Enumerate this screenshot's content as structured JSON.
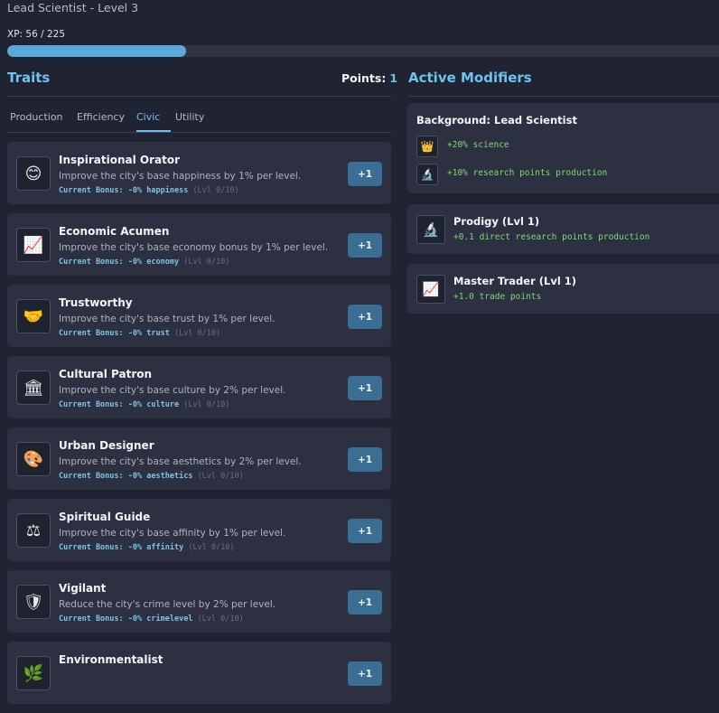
{
  "header": {
    "title": "Lead Scientist - Level 3",
    "xp_label": "XP: 56 / 225",
    "xp_progress": 0.249
  },
  "traits": {
    "heading": "Traits",
    "points_label": "Points:",
    "points_value": "1",
    "tabs": [
      {
        "label": "Production",
        "active": false
      },
      {
        "label": "Efficiency",
        "active": false
      },
      {
        "label": "Civic",
        "active": true
      },
      {
        "label": "Utility",
        "active": false
      }
    ],
    "cards": [
      {
        "icon": "smiley-face-icon",
        "glyph": "😊",
        "name": "Inspirational Orator",
        "desc": "Improve the city's base happiness by 1% per level.",
        "bonus_label": "Current Bonus:",
        "bonus_value": "-0% happiness",
        "level": "(Lvl 0/10)",
        "button": "+1"
      },
      {
        "icon": "chart-increasing-icon",
        "glyph": "📈",
        "name": "Economic Acumen",
        "desc": "Improve the city's base economy bonus by 1% per level.",
        "bonus_label": "Current Bonus:",
        "bonus_value": "-0% economy",
        "level": "(Lvl 0/10)",
        "button": "+1"
      },
      {
        "icon": "handshake-icon",
        "glyph": "🤝",
        "name": "Trustworthy",
        "desc": "Improve the city's base trust by 1% per level.",
        "bonus_label": "Current Bonus:",
        "bonus_value": "-0% trust",
        "level": "(Lvl 0/10)",
        "button": "+1"
      },
      {
        "icon": "classical-building-icon",
        "glyph": "🏛",
        "name": "Cultural Patron",
        "desc": "Improve the city's base culture by 2% per level.",
        "bonus_label": "Current Bonus:",
        "bonus_value": "-0% culture",
        "level": "(Lvl 0/10)",
        "button": "+1"
      },
      {
        "icon": "artist-palette-icon",
        "glyph": "🎨",
        "name": "Urban Designer",
        "desc": "Improve the city's base aesthetics by 2% per level.",
        "bonus_label": "Current Bonus:",
        "bonus_value": "-0% aesthetics",
        "level": "(Lvl 0/10)",
        "button": "+1"
      },
      {
        "icon": "balance-scale-icon",
        "glyph": "⚖",
        "name": "Spiritual Guide",
        "desc": "Improve the city's base affinity by 1% per level.",
        "bonus_label": "Current Bonus:",
        "bonus_value": "-0% affinity",
        "level": "(Lvl 0/10)",
        "button": "+1"
      },
      {
        "icon": "shield-icon",
        "glyph": "🛡",
        "name": "Vigilant",
        "desc": "Reduce the city's crime level by 2% per level.",
        "bonus_label": "Current Bonus:",
        "bonus_value": "-0% crimelevel",
        "level": "(Lvl 0/10)",
        "button": "+1"
      },
      {
        "icon": "leaf-icon",
        "glyph": "🌿",
        "name": "Environmentalist",
        "desc": "",
        "bonus_label": "",
        "bonus_value": "",
        "level": "",
        "button": "+1"
      }
    ]
  },
  "modifiers": {
    "heading": "Active Modifiers",
    "background": {
      "title": "Background: Lead Scientist",
      "rows": [
        {
          "icon": "crown-icon",
          "glyph": "👑",
          "text": "+20% science"
        },
        {
          "icon": "microscope-icon",
          "glyph": "🔬",
          "text": "+10% research points production"
        }
      ]
    },
    "items": [
      {
        "icon": "microscope-icon",
        "glyph": "🔬",
        "name": "Prodigy (Lvl 1)",
        "text": "+0.1 direct research points production"
      },
      {
        "icon": "chart-increasing-icon",
        "glyph": "📈",
        "name": "Master Trader (Lvl 1)",
        "text": "+1.0 trade points"
      }
    ]
  }
}
